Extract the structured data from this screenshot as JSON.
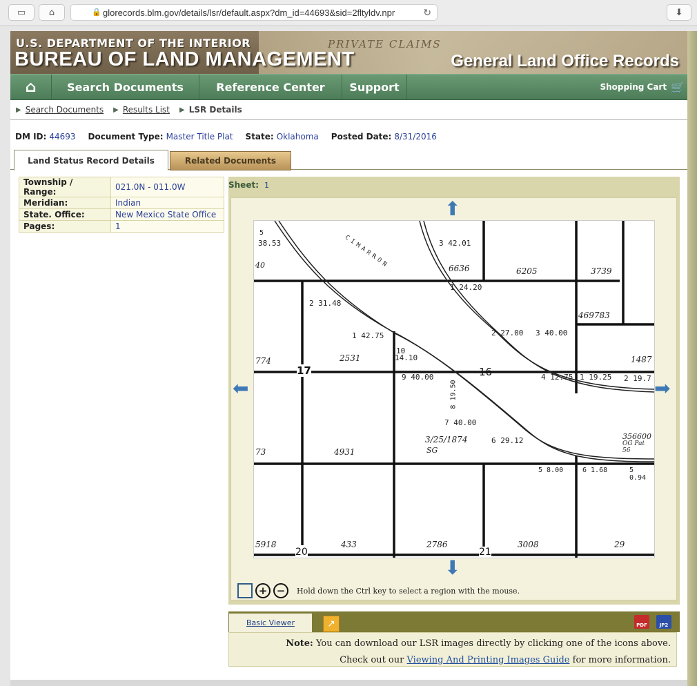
{
  "browser": {
    "url": "glorecords.blm.gov/details/lsr/default.aspx?dm_id=44693&sid=2fltyldv.npr"
  },
  "banner": {
    "dept": "U.S. DEPARTMENT OF THE INTERIOR",
    "bureau": "BUREAU OF LAND MANAGEMENT",
    "site": "General Land Office Records",
    "ghost": "PRIVATE CLAIMS"
  },
  "nav": {
    "items": [
      "Search Documents",
      "Reference Center",
      "Support"
    ],
    "cart": "Shopping Cart"
  },
  "breadcrumb": [
    "Search Documents",
    "Results List",
    "LSR Details"
  ],
  "meta": {
    "dm_id_label": "DM ID:",
    "dm_id": "44693",
    "doc_type_label": "Document Type:",
    "doc_type": "Master Title Plat",
    "state_label": "State:",
    "state": "Oklahoma",
    "posted_label": "Posted Date:",
    "posted": "8/31/2016"
  },
  "tabs": [
    "Land Status Record Details",
    "Related Documents"
  ],
  "details": [
    {
      "k": "Township / Range:",
      "v": "021.0N - 011.0W"
    },
    {
      "k": "Meridian:",
      "v": "Indian"
    },
    {
      "k": "State. Office:",
      "v": "New Mexico State Office"
    },
    {
      "k": "Pages:",
      "v": "1"
    }
  ],
  "viewer": {
    "sheet_label": "Sheet:",
    "sheet_value": "1",
    "hint": "Hold down the Ctrl key to select a region with the mouse.",
    "basic_viewer": "Basic Viewer",
    "pdf": "PDF",
    "jp2": "JP2"
  },
  "map": {
    "labels": [
      "5",
      "38.53",
      "40",
      "3 42.01",
      "6636",
      "6205",
      "3739",
      "1 24.20",
      "2 31.48",
      "469783",
      "1 42.75",
      "2 27.00",
      "3 40.00",
      "774",
      "2531",
      "10",
      "14.10",
      "17",
      "16",
      "1487",
      "9 40.00",
      "4 12.75",
      "1 19.25",
      "2 19.7",
      "8 19.50",
      "7 40.00",
      "3/25/1874",
      "6 29.12",
      "SG",
      "356600",
      "OG Pat 56",
      "73",
      "4931",
      "5 8.00",
      "6 1.68",
      "5 0.94",
      "5918",
      "433",
      "2786",
      "3008",
      "29",
      "20",
      "21",
      "CIMARRON"
    ]
  },
  "note": {
    "bold": "Note:",
    "line1": "You can download our LSR images directly by clicking one of the icons above.",
    "line2a": "Check out our",
    "link": "Viewing And Printing Images Guide",
    "line2b": "for more information."
  }
}
